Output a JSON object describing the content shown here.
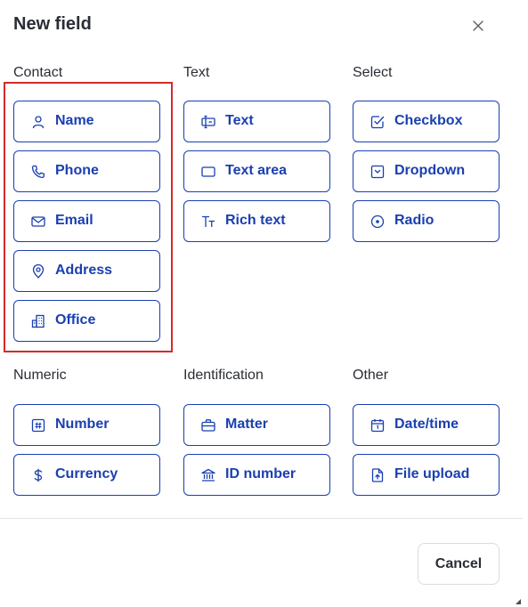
{
  "dialog": {
    "title": "New field",
    "cancel_label": "Cancel"
  },
  "colors": {
    "accent": "#1a3fb0",
    "highlight": "#d42a2a",
    "divider": "#e3e5ea"
  },
  "sections": {
    "contact": {
      "label": "Contact",
      "items": [
        {
          "label": "Name",
          "icon": "person-icon"
        },
        {
          "label": "Phone",
          "icon": "phone-icon"
        },
        {
          "label": "Email",
          "icon": "mail-icon"
        },
        {
          "label": "Address",
          "icon": "map-pin-icon"
        },
        {
          "label": "Office",
          "icon": "building-icon"
        }
      ]
    },
    "text": {
      "label": "Text",
      "items": [
        {
          "label": "Text",
          "icon": "text-cursor-icon"
        },
        {
          "label": "Text area",
          "icon": "rectangle-icon"
        },
        {
          "label": "Rich text",
          "icon": "font-size-icon"
        }
      ]
    },
    "select": {
      "label": "Select",
      "items": [
        {
          "label": "Checkbox",
          "icon": "checkbox-icon"
        },
        {
          "label": "Dropdown",
          "icon": "dropdown-icon"
        },
        {
          "label": "Radio",
          "icon": "radio-icon"
        }
      ]
    },
    "numeric": {
      "label": "Numeric",
      "items": [
        {
          "label": "Number",
          "icon": "hash-icon"
        },
        {
          "label": "Currency",
          "icon": "dollar-icon"
        }
      ]
    },
    "identification": {
      "label": "Identification",
      "items": [
        {
          "label": "Matter",
          "icon": "briefcase-icon"
        },
        {
          "label": "ID number",
          "icon": "bank-icon"
        }
      ]
    },
    "other": {
      "label": "Other",
      "items": [
        {
          "label": "Date/time",
          "icon": "calendar-icon"
        },
        {
          "label": "File upload",
          "icon": "file-upload-icon"
        }
      ]
    }
  }
}
